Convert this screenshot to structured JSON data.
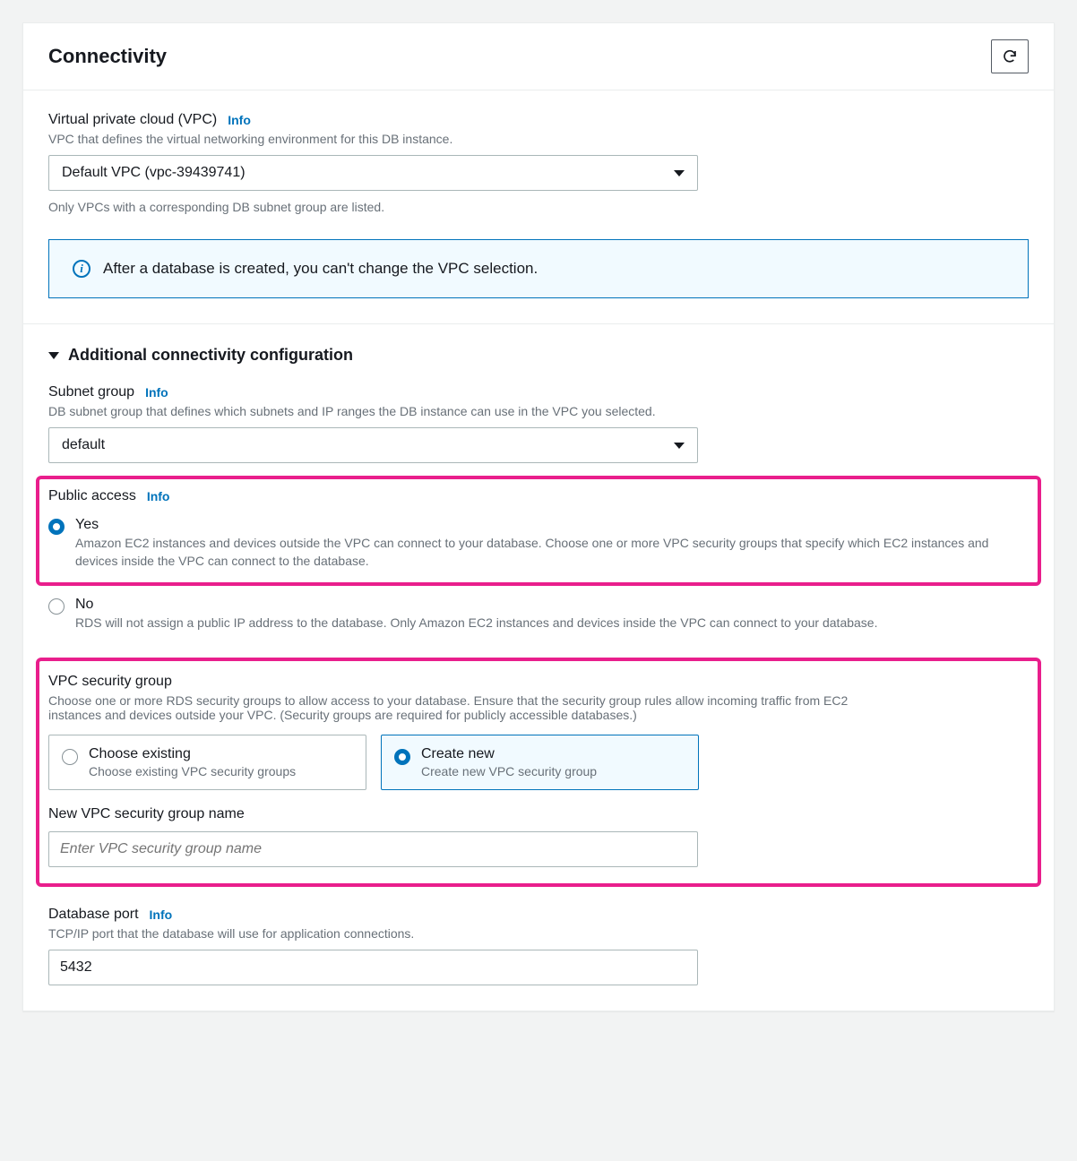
{
  "header": {
    "title": "Connectivity"
  },
  "vpc": {
    "label": "Virtual private cloud (VPC)",
    "info": "Info",
    "description": "VPC that defines the virtual networking environment for this DB instance.",
    "selected": "Default VPC (vpc-39439741)",
    "hint": "Only VPCs with a corresponding DB subnet group are listed."
  },
  "vpc_alert": "After a database is created, you can't change the VPC selection.",
  "expand": {
    "title": "Additional connectivity configuration"
  },
  "subnet": {
    "label": "Subnet group",
    "info": "Info",
    "description": "DB subnet group that defines which subnets and IP ranges the DB instance can use in the VPC you selected.",
    "selected": "default"
  },
  "public_access": {
    "label": "Public access",
    "info": "Info",
    "yes": {
      "label": "Yes",
      "desc": "Amazon EC2 instances and devices outside the VPC can connect to your database. Choose one or more VPC security groups that specify which EC2 instances and devices inside the VPC can connect to the database."
    },
    "no": {
      "label": "No",
      "desc": "RDS will not assign a public IP address to the database. Only Amazon EC2 instances and devices inside the VPC can connect to your database."
    }
  },
  "security_group": {
    "label": "VPC security group",
    "description": "Choose one or more RDS security groups to allow access to your database. Ensure that the security group rules allow incoming traffic from EC2 instances and devices outside your VPC. (Security groups are required for publicly accessible databases.)",
    "existing": {
      "title": "Choose existing",
      "desc": "Choose existing VPC security groups"
    },
    "createnew": {
      "title": "Create new",
      "desc": "Create new VPC security group"
    },
    "new_name_label": "New VPC security group name",
    "new_name_placeholder": "Enter VPC security group name"
  },
  "port": {
    "label": "Database port",
    "info": "Info",
    "description": "TCP/IP port that the database will use for application connections.",
    "value": "5432"
  }
}
